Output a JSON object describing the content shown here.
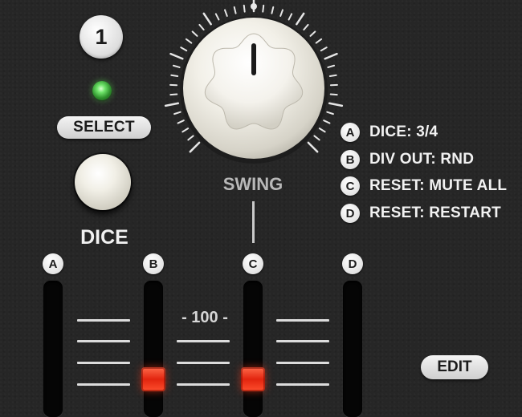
{
  "channel": {
    "number": "1"
  },
  "select": {
    "label": "SELECT"
  },
  "dice": {
    "label": "DICE"
  },
  "swing": {
    "label": "SWING"
  },
  "legend": [
    {
      "letter": "A",
      "text": "DICE: 3/4"
    },
    {
      "letter": "B",
      "text": "DIV OUT: RND"
    },
    {
      "letter": "C",
      "text": "RESET: MUTE ALL"
    },
    {
      "letter": "D",
      "text": "RESET: RESTART"
    }
  ],
  "faders": [
    {
      "letter": "A",
      "active": false
    },
    {
      "letter": "B",
      "active": true
    },
    {
      "letter": "C",
      "active": true
    },
    {
      "letter": "D",
      "active": false
    }
  ],
  "scale": {
    "label": "- 100 -"
  },
  "edit": {
    "label": "EDIT"
  },
  "colors": {
    "led": "#5fd65a",
    "fader_cap": "#ff3b1f",
    "panel": "#262626"
  }
}
